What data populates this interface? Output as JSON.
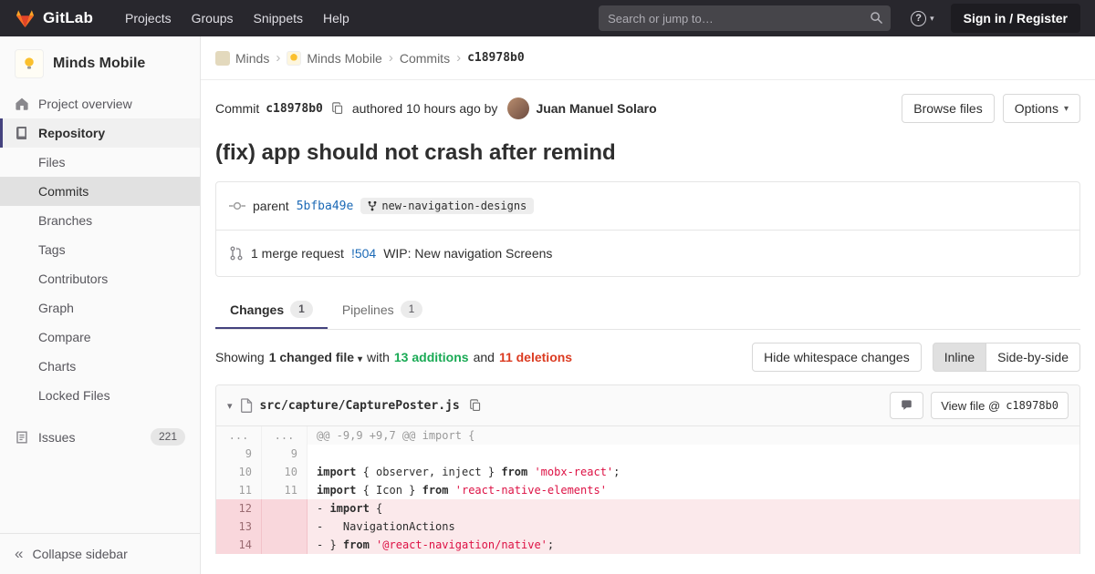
{
  "glyphs": {
    "caret": "▾",
    "separator": "›",
    "collapse": "«",
    "question": "?"
  },
  "colors": {
    "navbar_bg": "#28272d",
    "accent": "#44427e",
    "link": "#1b69b6",
    "addition_green": "#1aaa55",
    "deletion_red": "#db3b21",
    "deletion_line_bg": "#fbe9eb",
    "deletion_num_bg": "#f9d7dc",
    "brand": [
      "#e24329",
      "#fc6d26",
      "#fca326"
    ]
  },
  "navbar": {
    "brand": "GitLab",
    "menu": [
      "Projects",
      "Groups",
      "Snippets",
      "Help"
    ],
    "search_placeholder": "Search or jump to…",
    "signin": "Sign in / Register"
  },
  "sidebar": {
    "project_name": "Minds Mobile",
    "overview": "Project overview",
    "repository": "Repository",
    "repo_items": [
      "Files",
      "Commits",
      "Branches",
      "Tags",
      "Contributors",
      "Graph",
      "Compare",
      "Charts",
      "Locked Files"
    ],
    "issues": "Issues",
    "issues_count": "221",
    "collapse": "Collapse sidebar"
  },
  "breadcrumb": {
    "group": "Minds",
    "project": "Minds Mobile",
    "section": "Commits",
    "sha": "c18978b0"
  },
  "commit": {
    "label": "Commit",
    "sha": "c18978b0",
    "authored": "authored 10 hours ago by",
    "author": "Juan Manuel Solaro",
    "browse": "Browse files",
    "options": "Options",
    "title": "(fix) app should not crash after remind",
    "parent_label": "parent",
    "parent_sha": "5bfba49e",
    "branch": "new-navigation-designs",
    "mr_count": "1 merge request",
    "mr_ref": "!504",
    "mr_title": "WIP: New navigation Screens"
  },
  "tabs": {
    "changes": "Changes",
    "changes_count": "1",
    "pipelines": "Pipelines",
    "pipelines_count": "1"
  },
  "summary": {
    "showing": "Showing",
    "changed_file": "1 changed file",
    "with": "with",
    "additions": "13 additions",
    "and": "and",
    "deletions": "11 deletions",
    "hide_ws": "Hide whitespace changes",
    "inline": "Inline",
    "side_by_side": "Side-by-side"
  },
  "diff": {
    "file_path": "src/capture/CapturePoster.js",
    "view_file": "View file @",
    "view_sha": "c18978b0",
    "rows": [
      {
        "type": "hunk",
        "old": "...",
        "new": "...",
        "segs": [
          {
            "t": "@@ -9,9 +9,7 @@ import {"
          }
        ]
      },
      {
        "type": "ctx",
        "old": "9",
        "new": "9",
        "segs": [
          {
            "t": ""
          }
        ]
      },
      {
        "type": "ctx",
        "old": "10",
        "new": "10",
        "segs": [
          {
            "t": "import",
            "c": "k"
          },
          {
            "t": " { observer, inject } "
          },
          {
            "t": "from",
            "c": "k"
          },
          {
            "t": " "
          },
          {
            "t": "'mobx-react'",
            "c": "s"
          },
          {
            "t": ";"
          }
        ]
      },
      {
        "type": "ctx",
        "old": "11",
        "new": "11",
        "segs": [
          {
            "t": "import",
            "c": "k"
          },
          {
            "t": " { Icon } "
          },
          {
            "t": "from",
            "c": "k"
          },
          {
            "t": " "
          },
          {
            "t": "'react-native-elements'",
            "c": "s"
          }
        ]
      },
      {
        "type": "del",
        "old": "12",
        "new": "",
        "segs": [
          {
            "t": "- "
          },
          {
            "t": "import",
            "c": "k"
          },
          {
            "t": " {"
          }
        ]
      },
      {
        "type": "del",
        "old": "13",
        "new": "",
        "segs": [
          {
            "t": "-   NavigationActions"
          }
        ]
      },
      {
        "type": "del",
        "old": "14",
        "new": "",
        "segs": [
          {
            "t": "- } "
          },
          {
            "t": "from",
            "c": "k"
          },
          {
            "t": " "
          },
          {
            "t": "'@react-navigation/native'",
            "c": "s"
          },
          {
            "t": ";"
          }
        ]
      }
    ]
  }
}
